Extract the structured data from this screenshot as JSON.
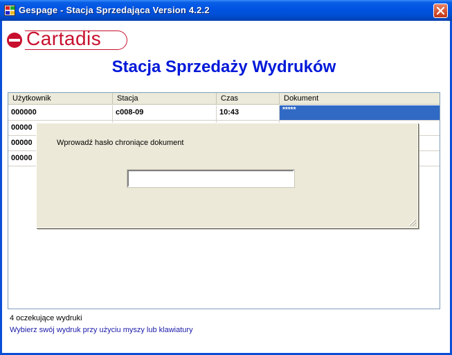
{
  "window": {
    "title": "Gespage - Stacja Sprzedająca Version 4.2.2",
    "close_symbol": "✕"
  },
  "logo": {
    "text": "Cartadis",
    "icon": "cartadis-logo-icon",
    "color": "#c8102e"
  },
  "heading": "Stacja Sprzedaży Wydruków",
  "table": {
    "columns": [
      "Użytkownik",
      "Stacja",
      "Czas",
      "Dokument"
    ],
    "rows": [
      {
        "user": "000000",
        "station": "c008-09",
        "time": "10:43",
        "document": "*****"
      },
      {
        "user": "00000",
        "station": "",
        "time": "",
        "document": ""
      },
      {
        "user": "00000",
        "station": "",
        "time": "",
        "document": ""
      },
      {
        "user": "00000",
        "station": "",
        "time": "",
        "document": ""
      }
    ]
  },
  "dialog": {
    "label": "Wprowadź hasło chroniące dokument",
    "password_value": ""
  },
  "status": {
    "count": "4 oczekujące wydruki",
    "hint": "Wybierz swój wydruk przy użyciu myszy lub klawiatury"
  },
  "colors": {
    "title_bar": "#0054e3",
    "heading": "#0018d8",
    "selection": "#316ac5",
    "dialog_bg": "#ece9d8"
  }
}
